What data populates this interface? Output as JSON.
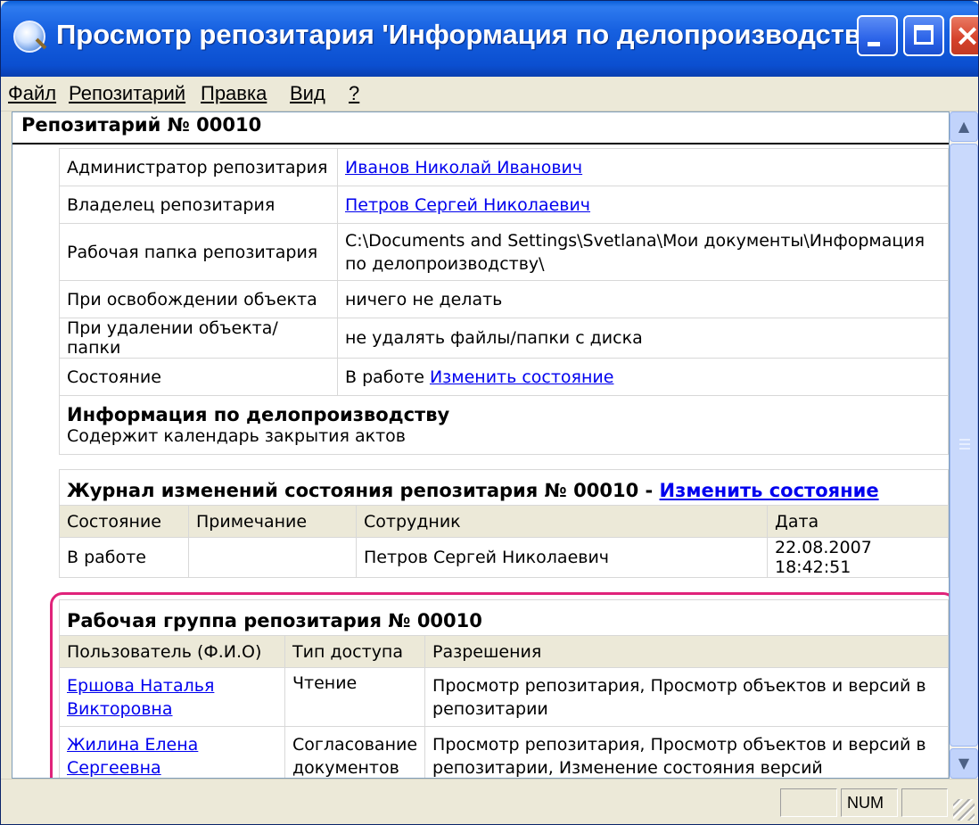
{
  "window": {
    "title": "Просмотр репозитария 'Информация по делопроизводству'"
  },
  "menu": {
    "items": [
      "Файл",
      "Репозитарий",
      "Правка",
      "Вид",
      "?"
    ]
  },
  "repository": {
    "header": "Репозитарий № 00010",
    "properties": [
      {
        "label": "Администратор репозитария",
        "value": "Иванов Николай Иванович",
        "link": true
      },
      {
        "label": "Владелец репозитария",
        "value": "Петров Сергей Николаевич",
        "link": true
      },
      {
        "label": "Рабочая папка репозитария",
        "value": "C:\\Documents and Settings\\Svetlana\\Мои документы\\Информация по делопроизводству\\"
      },
      {
        "label": "При освобождении объекта",
        "value": "ничего не делать"
      },
      {
        "label": "При удалении объекта/папки",
        "value": "не удалять файлы/папки с диска"
      },
      {
        "label": "Состояние",
        "value": "В работе",
        "action": "Изменить состояние"
      }
    ],
    "info_title": "Информация по делопроизводству",
    "info_text": "Содержит календарь закрытия актов"
  },
  "state_log": {
    "title": "Журнал изменений состояния репозитария № 00010 - ",
    "title_link": "Изменить состояние",
    "columns": [
      "Состояние",
      "Примечание",
      "Сотрудник",
      "Дата"
    ],
    "rows": [
      [
        "В работе",
        "",
        "Петров Сергей Николаевич",
        "22.08.2007 18:42:51"
      ]
    ]
  },
  "work_group": {
    "title": "Рабочая группа репозитария № 00010",
    "columns": [
      "Пользователь (Ф.И.О)",
      "Тип доступа",
      "Разрешения"
    ],
    "rows": [
      {
        "user": "Ершова Наталья Викторовна",
        "access": "Чтение",
        "permissions": "Просмотр репозитария, Просмотр объектов и версий в репозитарии"
      },
      {
        "user": "Жилина Елена Сергеевна",
        "access": "Согласование документов",
        "permissions": "Просмотр репозитария, Просмотр объектов и версий в репозитарии, Изменение состояния версий"
      }
    ]
  },
  "statusbar": {
    "num": "NUM"
  },
  "colors": {
    "titlebar": "#0A5FD8",
    "link": "#0000EE",
    "highlight": "#E0237A",
    "chrome": "#ECE9D8"
  }
}
